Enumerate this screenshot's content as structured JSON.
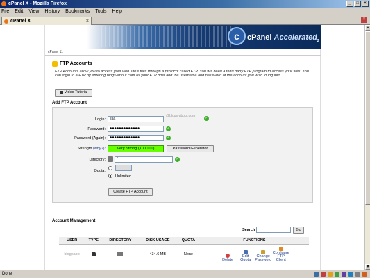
{
  "window": {
    "title": "cPanel X - Mozilla Firefox"
  },
  "menu": [
    "File",
    "Edit",
    "View",
    "History",
    "Bookmarks",
    "Tools",
    "Help"
  ],
  "tab": {
    "label": "cPanel X"
  },
  "banner": {
    "brand": "cPanel",
    "brand_suffix": "Accelerated",
    "brand_sub": "2",
    "logo_letter": "c"
  },
  "breadcrumb": "cPanel 11",
  "ftp": {
    "title": "FTP Accounts",
    "description": "FTP Accounts allow you to access your web site's files through a protocol called FTP. You will need a third party FTP program to access your files. You can login to a FTP by entering blogs-about.com as your FTP host and the username and password of the account you wish to log into.",
    "video_button": "Video Tutorial"
  },
  "add": {
    "title": "Add FTP Account",
    "login_label": "Login:",
    "login_value": "lisa",
    "domain_hint": "@blogs-about.com",
    "password_label": "Password:",
    "password_value": "●●●●●●●●●●●●●",
    "password_again_label": "Password (Again):",
    "password_again_value": "●●●●●●●●●●●●●",
    "strength_label": "Strength",
    "strength_why": "(why?):",
    "strength_value": "Very Strong (100/100)",
    "generator_button": "Password Generator",
    "directory_label": "Directory:",
    "directory_value": "/",
    "quota_label": "Quota:",
    "quota_value": "",
    "unlimited_label": "Unlimited",
    "create_button": "Create FTP Account"
  },
  "management": {
    "title": "Account Management",
    "search_label": "Search",
    "search_value": "",
    "go_button": "Go",
    "columns": [
      "USER",
      "TYPE",
      "DIRECTORY",
      "DISK USAGE",
      "QUOTA",
      "FUNCTIONS"
    ],
    "row": {
      "user": "blogsabo",
      "disk_usage": "434.6 MB",
      "quota": "None",
      "functions": [
        "Delete",
        "Edit Quota",
        "Change Password",
        "Configure FTP Client"
      ]
    }
  },
  "status": {
    "text": "Done"
  }
}
